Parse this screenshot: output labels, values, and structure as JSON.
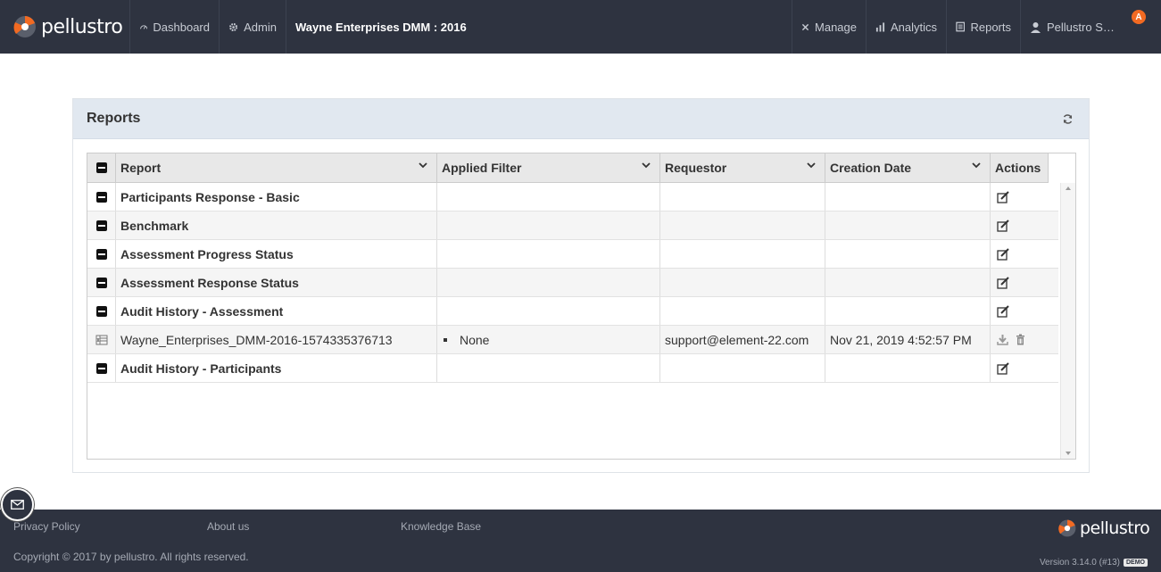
{
  "brand": {
    "name": "pellustro",
    "accent": "#f26a22"
  },
  "nav": {
    "dashboard": "Dashboard",
    "admin": "Admin",
    "context_title": "Wayne Enterprises DMM : 2016",
    "manage": "Manage",
    "analytics": "Analytics",
    "reports": "Reports",
    "user_name": "Pellustro Su…",
    "notification_badge": "A"
  },
  "panel": {
    "title": "Reports"
  },
  "grid": {
    "columns": [
      "Report",
      "Applied Filter",
      "Requestor",
      "Creation Date",
      "Actions"
    ],
    "rows": [
      {
        "type": "group",
        "report": "Participants Response - Basic",
        "filter": "",
        "requestor": "",
        "date": ""
      },
      {
        "type": "group",
        "report": "Benchmark",
        "filter": "",
        "requestor": "",
        "date": ""
      },
      {
        "type": "group",
        "report": "Assessment Progress Status",
        "filter": "",
        "requestor": "",
        "date": ""
      },
      {
        "type": "group",
        "report": "Assessment Response Status",
        "filter": "",
        "requestor": "",
        "date": ""
      },
      {
        "type": "group",
        "report": "Audit History - Assessment",
        "filter": "",
        "requestor": "",
        "date": ""
      },
      {
        "type": "file",
        "report": "Wayne_Enterprises_DMM-2016-1574335376713",
        "filter": "None",
        "requestor": "support@element-22.com",
        "date": "Nov 21, 2019 4:52:57 PM"
      },
      {
        "type": "group",
        "report": "Audit History - Participants",
        "filter": "",
        "requestor": "",
        "date": ""
      }
    ]
  },
  "footer": {
    "privacy": "Privacy Policy",
    "about": "About us",
    "knowledge_base": "Knowledge Base",
    "copyright": "Copyright © 2017 by pellustro. All rights reserved.",
    "brand": "pellustro",
    "version": "Version 3.14.0 (#13)",
    "demo": "DEMO"
  }
}
